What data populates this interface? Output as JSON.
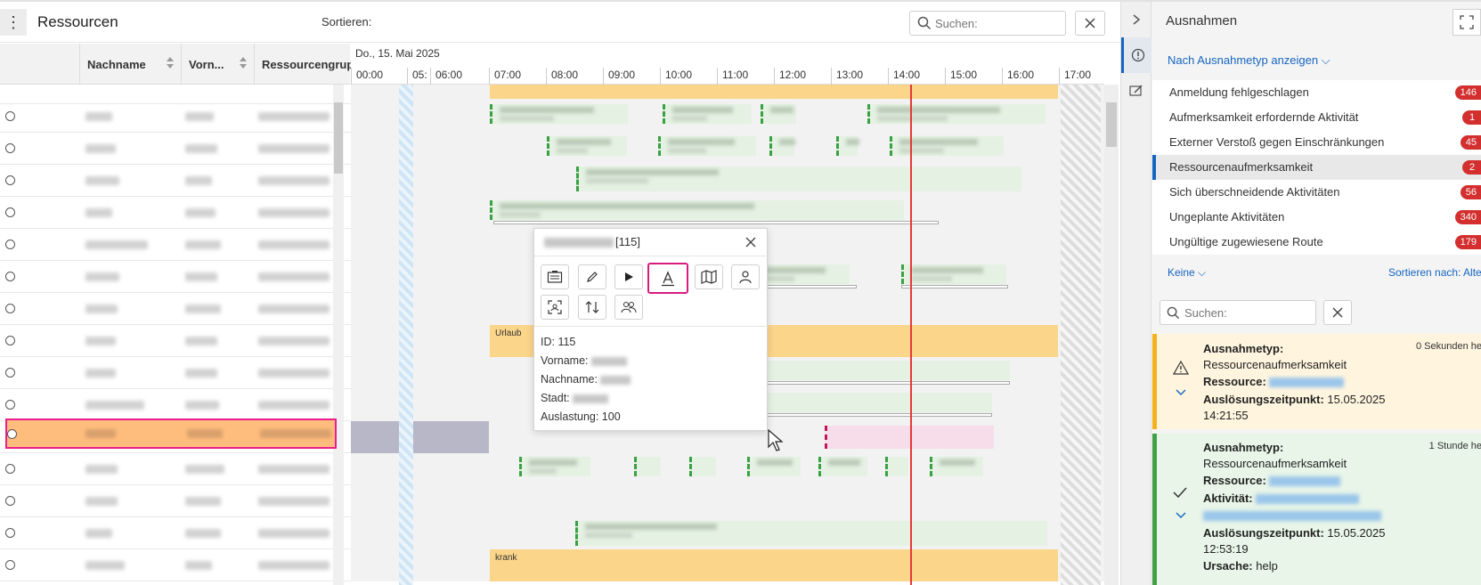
{
  "header": {
    "title": "Ressourcen",
    "sort_label": "Sortieren:",
    "search_placeholder": "Suchen:"
  },
  "table": {
    "columns": [
      "Nachname",
      "Vorn...",
      "Ressourcengrup"
    ]
  },
  "gantt": {
    "date": "Do., 15. Mai 2025",
    "ticks": [
      "00:00",
      "05:",
      "06:00",
      "07:00",
      "08:00",
      "09:00",
      "10:00",
      "11:00",
      "12:00",
      "13:00",
      "14:00",
      "15:00",
      "16:00",
      "17:00"
    ],
    "labels": {
      "urlaub": "Urlaub",
      "krank": "krank"
    }
  },
  "popup": {
    "title_suffix": "[115]",
    "id_line": "ID: 115",
    "vorname_label": "Vorname:",
    "nachname_label": "Nachname:",
    "stadt_label": "Stadt:",
    "auslastung_line": "Auslastung: 100",
    "buttons": [
      "details-icon",
      "edit-icon",
      "play-icon",
      "text-icon",
      "map-icon",
      "person-icon",
      "focus-icon",
      "swap-icon",
      "group-icon"
    ]
  },
  "exceptions": {
    "title": "Ausnahmen",
    "view_by": "Nach Ausnahmetyp anzeigen",
    "items": [
      {
        "label": "Anmeldung fehlgeschlagen",
        "count": "146"
      },
      {
        "label": "Aufmerksamkeit erfordernde Aktivität",
        "count": "1"
      },
      {
        "label": "Externer Verstoß gegen Einschränkungen",
        "count": "45"
      },
      {
        "label": "Ressourcenaufmerksamkeit",
        "count": "2"
      },
      {
        "label": "Sich überschneidende Aktivitäten",
        "count": "56"
      },
      {
        "label": "Ungeplante Aktivitäten",
        "count": "340"
      },
      {
        "label": "Ungültige zugewiesene Route",
        "count": "179"
      }
    ],
    "filter": "Keine",
    "sort_by": "Sortieren nach: Alter",
    "search_placeholder": "Suchen:",
    "cards": [
      {
        "type_label": "Ausnahmetyp:",
        "type_value": "Ressourcenaufmerksamkeit",
        "resource_label": "Ressource:",
        "trigger_label": "Auslösungszeitpunkt:",
        "trigger_date": "15.05.2025",
        "trigger_time": "14:21:55",
        "age": "0 Sekunden he"
      },
      {
        "type_label": "Ausnahmetyp:",
        "type_value": "Ressourcenaufmerksamkeit",
        "resource_label": "Ressource:",
        "activity_label": "Aktivität:",
        "trigger_label": "Auslösungszeitpunkt:",
        "trigger_date": "15.05.2025",
        "trigger_time": "12:53:19",
        "cause_label": "Ursache:",
        "cause_value": "help",
        "age": "1 Stunde he"
      }
    ]
  },
  "colors": {
    "accent": "#1565c0",
    "badge": "#d32f2f",
    "now_line": "#e53935",
    "absence": "#fbd589",
    "selection": "#e91e8c"
  }
}
